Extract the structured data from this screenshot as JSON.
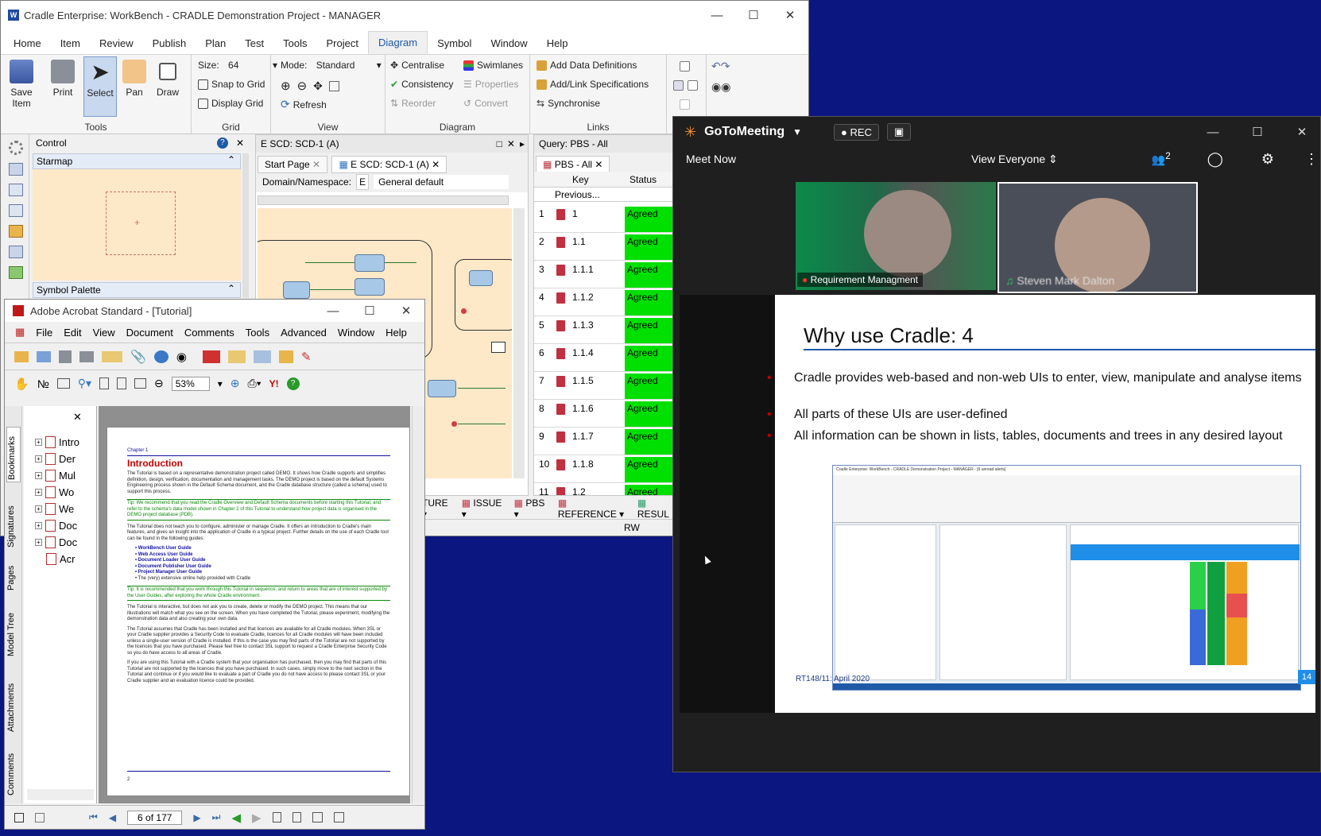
{
  "cradle": {
    "title": "Cradle Enterprise: WorkBench - CRADLE Demonstration Project - MANAGER",
    "menu": [
      "Home",
      "Item",
      "Review",
      "Publish",
      "Plan",
      "Test",
      "Tools",
      "Project",
      "Diagram",
      "Symbol",
      "Window",
      "Help"
    ],
    "active_menu": "Diagram",
    "ribbon": {
      "save_item": "Save Item",
      "print": "Print",
      "select": "Select",
      "pan": "Pan",
      "draw": "Draw",
      "tools_label": "Tools",
      "size_label": "Size:",
      "size_value": "64",
      "snap_to_grid": "Snap to Grid",
      "display_grid": "Display Grid",
      "grid_label": "Grid",
      "mode_label": "Mode:",
      "mode_value": "Standard",
      "refresh": "Refresh",
      "view_label": "View",
      "centralise": "Centralise",
      "swimlanes": "Swimlanes",
      "consistency": "Consistency",
      "properties": "Properties",
      "reorder": "Reorder",
      "convert": "Convert",
      "diagram_label": "Diagram",
      "add_data_definitions": "Add Data Definitions",
      "add_link_specifications": "Add/Link Specifications",
      "synchronise": "Synchronise",
      "links_label": "Links"
    },
    "control": {
      "title": "Control",
      "starmap": "Starmap",
      "symbol_palette": "Symbol Palette"
    },
    "diagram_panel": {
      "title": "E SCD: SCD-1 (A)",
      "tabs": [
        "Start Page",
        "E SCD: SCD-1 (A)"
      ],
      "domain_label": "Domain/Namespace:",
      "domain_e": "E",
      "domain_value": "General default"
    },
    "query_panel": {
      "title": "Query: PBS - All",
      "tab": "PBS - All",
      "col_key": "Key",
      "col_status": "Status",
      "previous": "Previous...",
      "rows": [
        {
          "n": "1",
          "key": "1",
          "status": "Agreed"
        },
        {
          "n": "2",
          "key": "1.1",
          "status": "Agreed"
        },
        {
          "n": "3",
          "key": "1.1.1",
          "status": "Agreed"
        },
        {
          "n": "4",
          "key": "1.1.2",
          "status": "Agreed"
        },
        {
          "n": "5",
          "key": "1.1.3",
          "status": "Agreed"
        },
        {
          "n": "6",
          "key": "1.1.4",
          "status": "Agreed"
        },
        {
          "n": "7",
          "key": "1.1.5",
          "status": "Agreed"
        },
        {
          "n": "8",
          "key": "1.1.6",
          "status": "Agreed"
        },
        {
          "n": "9",
          "key": "1.1.7",
          "status": "Agreed"
        },
        {
          "n": "10",
          "key": "1.1.8",
          "status": "Agreed"
        },
        {
          "n": "11",
          "key": "1.2",
          "status": "Agreed"
        }
      ]
    },
    "bottom_tabs": [
      "TURE",
      "ISSUE",
      "PBS",
      "REFERENCE",
      "RESUL"
    ],
    "status_rw": "RW"
  },
  "acrobat": {
    "title": "Adobe Acrobat Standard - [Tutorial]",
    "menu": [
      "File",
      "Edit",
      "View",
      "Document",
      "Comments",
      "Tools",
      "Advanced",
      "Window",
      "Help"
    ],
    "zoom": "53%",
    "side_tabs": [
      "Bookmarks",
      "Signatures",
      "Pages",
      "Model Tree",
      "Attachments",
      "Comments"
    ],
    "bookmarks": [
      "Intro",
      "Der",
      "Mul",
      "Wo",
      "We",
      "Doc",
      "Doc",
      "Acr"
    ],
    "page_nav": "6 of 177",
    "doc": {
      "chapter": "Chapter 1",
      "heading": "Introduction",
      "p1": "The Tutorial is based on a representative demonstration project called DEMO. It shows how Cradle supports and simplifies definition, design, verification, documentation and management tasks. The DEMO project is based on the default Systems Engineering process shown in the Default Schema document, and the Cradle database structure (called a schema) used to support this process.",
      "tip1": "Tip: We recommend that you read the Cradle Overview and Default Schema documents before starting this Tutorial, and refer to the schema's data model shown in Chapter 2 of this Tutorial to understand how project data is organised in the DEMO project database (PDB).",
      "p2": "The Tutorial does not teach you to configure, administer or manage Cradle. It offers an introduction to Cradle's main features, and gives an insight into the application of Cradle in a typical project. Further details on the use of each Cradle tool can be found in the following guides:",
      "guides": [
        "WorkBench User Guide",
        "Web Access User Guide",
        "Document Loader User Guide",
        "Document Publisher User Guide",
        "Project Manager User Guide"
      ],
      "guides_last": "The (very) extensive online help provided with Cradle",
      "tip2": "Tip: It is recommended that you work through this Tutorial in sequence, and return to areas that are of interest supported by the User Guides, after exploring the whole Cradle environment.",
      "p3": "The Tutorial is interactive, but does not ask you to create, delete or modify the DEMO project. This means that our illustrations will match what you see on the screen. When you have completed the Tutorial, please experiment, modifying the demonstration data and also creating your own data.",
      "p4": "The Tutorial assumes that Cradle has been installed and that licences are available for all Cradle modules. When 3SL or your Cradle supplier provides a Security Code to evaluate Cradle, licences for all Cradle modules will have been included unless a single-user version of Cradle is installed. If this is the case you may find parts of the Tutorial are not supported by the licences that you have purchased. Please feel free to contact 3SL support to request a Cradle Enterprise Security Code so you do have access to all areas of Cradle.",
      "p5": "If you are using this Tutorial with a Cradle system that your organisation has purchased, then you may find that parts of this Tutorial are not supported by the licences that you have purchased. In such cases, simply move to the next section in the Tutorial and continue or if you would like to evaluate a part of Cradle you do not have access to please contact 3SL or your Cradle supplier and an evaluation licence could be provided.",
      "page_no": "2"
    }
  },
  "goto": {
    "app_name": "GoToMeeting",
    "rec": "REC",
    "meet_now": "Meet Now",
    "view_everyone": "View Everyone",
    "participants_count": "2",
    "video1_label": "Requirement Managment",
    "video2_label": "Steven Mark Dalton",
    "slide": {
      "title": "Why use Cradle: 4",
      "bullets": [
        "Cradle provides web-based and non-web UIs to enter, view, manipulate and analyse items",
        "All parts of these UIs are user-defined",
        "All information can be shown in lists, tables, documents and trees in any desired layout"
      ],
      "footer": "RT148/11: April 2020",
      "page": "14",
      "mini_title": "Cradle Enterprise: WorkBench - CRADLE Demonstration Project - MANAGER - [6 unread alerts]"
    }
  },
  "colors": {
    "agreed": "#00e000",
    "brand_orange": "#f68d2e",
    "slide_red": "#c00000",
    "accent_blue": "#1e5aa8"
  }
}
